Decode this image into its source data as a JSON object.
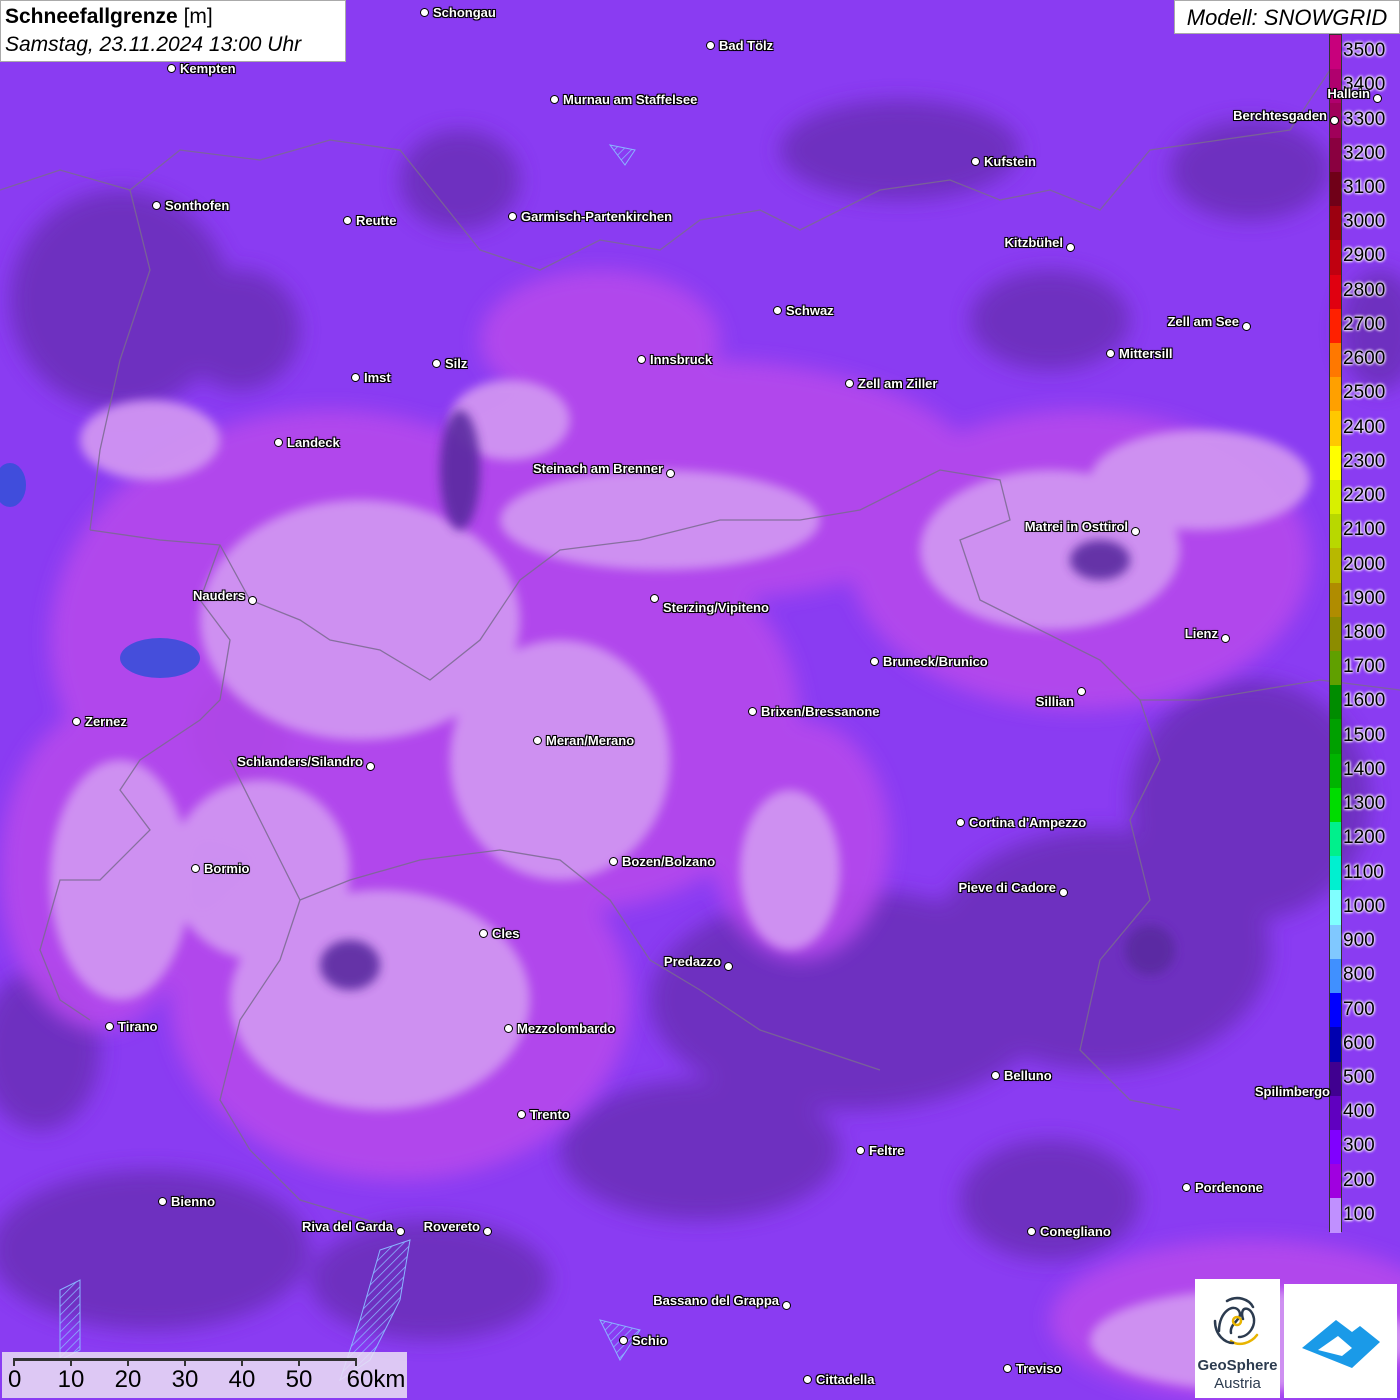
{
  "header": {
    "title_bold": "Schneefallgrenze",
    "title_unit": "[m]",
    "subtitle": "Samstag, 23.11.2024 13:00 Uhr",
    "model": "Modell: SNOWGRID"
  },
  "legend": {
    "labels": [
      "3500",
      "3400",
      "3300",
      "3200",
      "3100",
      "3000",
      "2900",
      "2800",
      "2700",
      "2600",
      "2500",
      "2400",
      "2300",
      "2200",
      "2100",
      "2000",
      "1900",
      "1800",
      "1700",
      "1600",
      "1500",
      "1400",
      "1300",
      "1200",
      "1100",
      "1000",
      "900",
      "800",
      "700",
      "600",
      "500",
      "400",
      "300",
      "200",
      "100"
    ],
    "colors": [
      "#c8007c",
      "#b0006e",
      "#a0005a",
      "#8a0040",
      "#700018",
      "#9c0010",
      "#c00010",
      "#e00010",
      "#ff2000",
      "#ff7800",
      "#ffa000",
      "#ffc800",
      "#ffff00",
      "#d8f000",
      "#b8d800",
      "#b8b800",
      "#b08c00",
      "#8c8c00",
      "#60a000",
      "#008c00",
      "#00a000",
      "#00b400",
      "#00dc00",
      "#00f08c",
      "#00f0d0",
      "#80ffff",
      "#80c8ff",
      "#4090ff",
      "#0000ff",
      "#0000b0",
      "#400090",
      "#6000c0",
      "#8000ff",
      "#a000e0",
      "#c090ff"
    ]
  },
  "cities": [
    {
      "name": "Schongau"
    },
    {
      "name": "Bad Tölz"
    },
    {
      "name": "Kempten"
    },
    {
      "name": "Murnau am Staffelsee"
    },
    {
      "name": "Hallein"
    },
    {
      "name": "Berchtesgaden"
    },
    {
      "name": "Kufstein"
    },
    {
      "name": "Sonthofen"
    },
    {
      "name": "Reutte"
    },
    {
      "name": "Garmisch-Partenkirchen"
    },
    {
      "name": "Kitzbühel"
    },
    {
      "name": "Schwaz"
    },
    {
      "name": "Zell am See"
    },
    {
      "name": "Mittersill"
    },
    {
      "name": "Innsbruck"
    },
    {
      "name": "Silz"
    },
    {
      "name": "Imst"
    },
    {
      "name": "Zell am Ziller"
    },
    {
      "name": "Landeck"
    },
    {
      "name": "Steinach am Brenner"
    },
    {
      "name": "Matrei in Osttirol"
    },
    {
      "name": "Nauders"
    },
    {
      "name": "Sterzing/Vipiteno"
    },
    {
      "name": "Lienz"
    },
    {
      "name": "Bruneck/Brunico"
    },
    {
      "name": "Sillian"
    },
    {
      "name": "Brixen/Bressanone"
    },
    {
      "name": "Zernez"
    },
    {
      "name": "Meran/Merano"
    },
    {
      "name": "Schlanders/Silandro"
    },
    {
      "name": "Cortina d'Ampezzo"
    },
    {
      "name": "Bozen/Bolzano"
    },
    {
      "name": "Bormio"
    },
    {
      "name": "Pieve di Cadore"
    },
    {
      "name": "Cles"
    },
    {
      "name": "Predazzo"
    },
    {
      "name": "Tirano"
    },
    {
      "name": "Mezzolombardo"
    },
    {
      "name": "Belluno"
    },
    {
      "name": "Spilimbergo"
    },
    {
      "name": "Trento"
    },
    {
      "name": "Feltre"
    },
    {
      "name": "Pordenone"
    },
    {
      "name": "Bienno"
    },
    {
      "name": "Riva del Garda"
    },
    {
      "name": "Rovereto"
    },
    {
      "name": "Conegliano"
    },
    {
      "name": "Bassano del Grappa"
    },
    {
      "name": "Schio"
    },
    {
      "name": "Treviso"
    },
    {
      "name": "Cittadella"
    }
  ],
  "scale": {
    "labels": [
      "0",
      "10",
      "20",
      "30",
      "40",
      "50",
      "60km"
    ]
  },
  "logo": {
    "line1": "GeoSphere",
    "line2": "Austria"
  }
}
